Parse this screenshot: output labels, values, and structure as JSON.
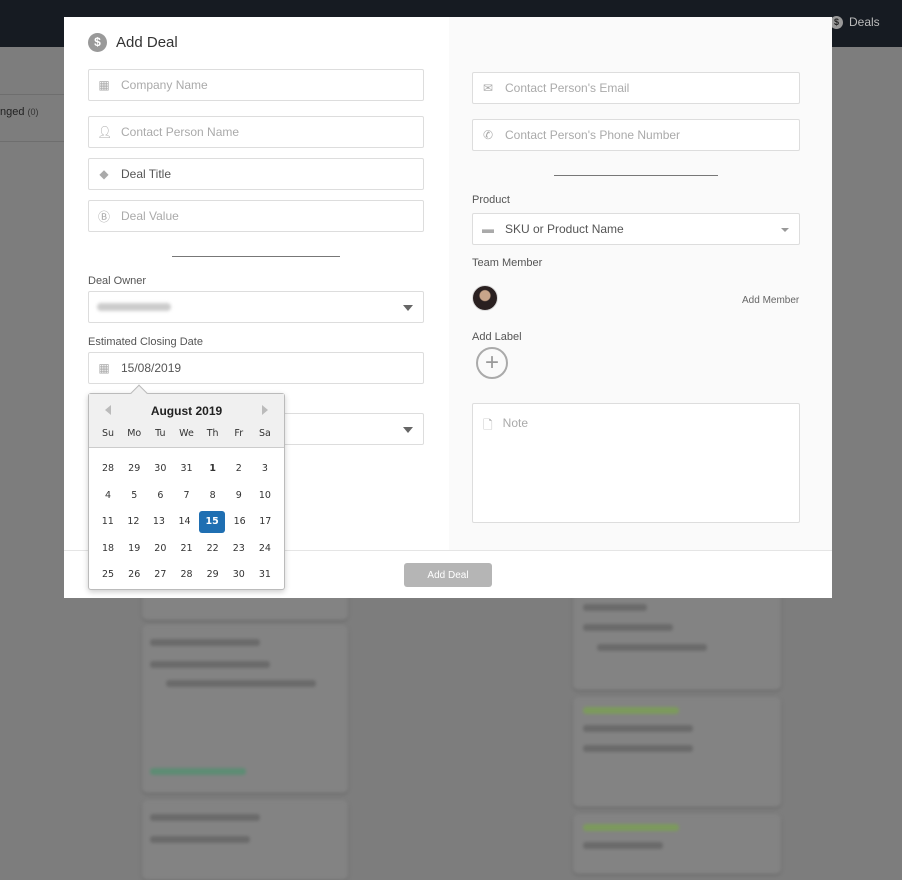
{
  "background": {
    "nav_deals": "Deals",
    "tab_label": "nged",
    "tab_count": "(0)"
  },
  "modal": {
    "title": "Add Deal",
    "company_name": {
      "placeholder": "Company Name",
      "icon": "building-icon"
    },
    "contact_person_name": {
      "placeholder": "Contact Person Name",
      "icon": "user-icon"
    },
    "deal_title": {
      "value": "Deal Title",
      "icon": "tag-icon"
    },
    "deal_value": {
      "placeholder": "Deal Value",
      "icon": "baht-icon"
    },
    "deal_owner_label": "Deal Owner",
    "estimated_closing_date_label": "Estimated Closing Date",
    "estimated_closing_date": "15/08/2019",
    "email": {
      "placeholder": "Contact Person's Email",
      "icon": "envelope-icon"
    },
    "phone": {
      "placeholder": "Contact Person's Phone Number",
      "icon": "phone-icon"
    },
    "product_label": "Product",
    "product_select": "SKU or Product Name",
    "team_member_label": "Team Member",
    "add_member": "Add Member",
    "add_label": "Add Label",
    "note_placeholder": "Note",
    "submit": "Add Deal"
  },
  "calendar": {
    "month_title": "August 2019",
    "weekdays": [
      "Su",
      "Mo",
      "Tu",
      "We",
      "Th",
      "Fr",
      "Sa"
    ],
    "weeks": [
      [
        "28",
        "29",
        "30",
        "31",
        "1",
        "2",
        "3"
      ],
      [
        "4",
        "5",
        "6",
        "7",
        "8",
        "9",
        "10"
      ],
      [
        "11",
        "12",
        "13",
        "14",
        "15",
        "16",
        "17"
      ],
      [
        "18",
        "19",
        "20",
        "21",
        "22",
        "23",
        "24"
      ],
      [
        "25",
        "26",
        "27",
        "28",
        "29",
        "30",
        "31"
      ]
    ],
    "selected": "15",
    "selected_color": "#1f6fb2"
  }
}
